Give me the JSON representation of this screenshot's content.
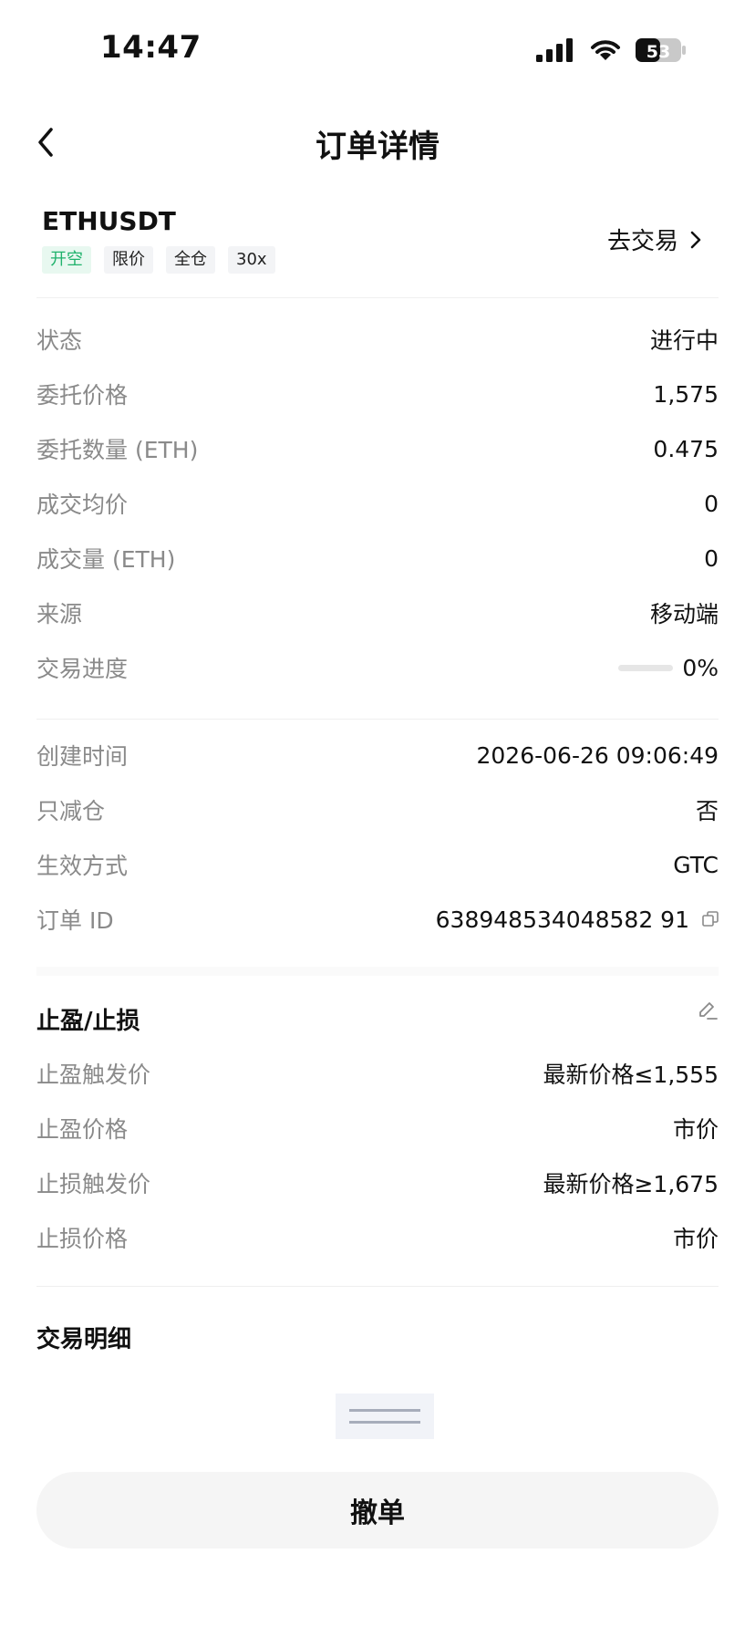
{
  "status_bar": {
    "time": "14:47",
    "battery": "53"
  },
  "header": {
    "title": "订单详情"
  },
  "symbol": {
    "name": "ETHUSDT",
    "tags": [
      "开空",
      "限价",
      "全仓",
      "30x"
    ],
    "go_trade": "去交易"
  },
  "order": {
    "status_label": "状态",
    "status_value": "进行中",
    "price_label": "委托价格",
    "price_value": "1,575",
    "qty_label": "委托数量 (ETH)",
    "qty_value": "0.475",
    "avg_label": "成交均价",
    "avg_value": "0",
    "filled_label": "成交量 (ETH)",
    "filled_value": "0",
    "source_label": "来源",
    "source_value": "移动端",
    "progress_label": "交易进度",
    "progress_value": "0%",
    "progress_fraction": 0
  },
  "meta": {
    "created_label": "创建时间",
    "created_value": "2026-06-26 09:06:49",
    "reduce_label": "只减仓",
    "reduce_value": "否",
    "tif_label": "生效方式",
    "tif_value": "GTC",
    "id_label": "订单 ID",
    "id_value": "638948534048582 91"
  },
  "tpsl": {
    "title": "止盈/止损",
    "tp_trigger_label": "止盈触发价",
    "tp_trigger_value": "最新价格≤1,555",
    "tp_price_label": "止盈价格",
    "tp_price_value": "市价",
    "sl_trigger_label": "止损触发价",
    "sl_trigger_value": "最新价格≥1,675",
    "sl_price_label": "止损价格",
    "sl_price_value": "市价"
  },
  "trades": {
    "title": "交易明细"
  },
  "actions": {
    "cancel_label": "撤单"
  },
  "colors": {
    "accent_green": "#20b26c",
    "label_gray": "#8a8a8a"
  }
}
